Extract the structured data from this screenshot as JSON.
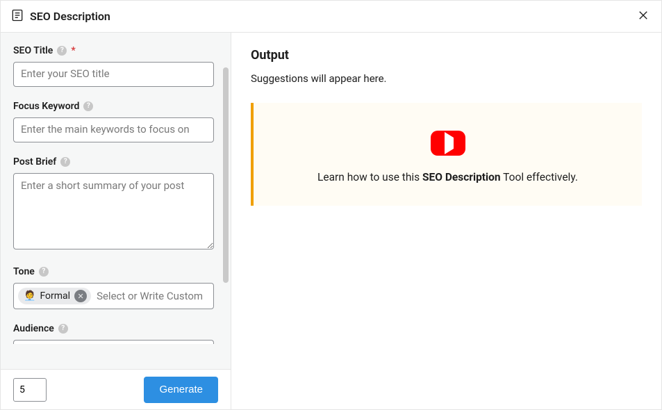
{
  "header": {
    "title": "SEO Description"
  },
  "form": {
    "seo_title": {
      "label": "SEO Title",
      "placeholder": "Enter your SEO title",
      "required_mark": "*"
    },
    "focus_keyword": {
      "label": "Focus Keyword",
      "placeholder": "Enter the main keywords to focus on"
    },
    "post_brief": {
      "label": "Post Brief",
      "placeholder": "Enter a short summary of your post"
    },
    "tone": {
      "label": "Tone",
      "chip_emoji": "🧑‍💼",
      "chip_text": "Formal",
      "placeholder": "Select or Write Custom"
    },
    "audience": {
      "label": "Audience"
    }
  },
  "footer": {
    "count": "5",
    "button": "Generate"
  },
  "output": {
    "title": "Output",
    "subtitle": "Suggestions will appear here.",
    "video": {
      "prefix": "Learn how to use this ",
      "bold": "SEO Description",
      "suffix": " Tool effectively."
    }
  }
}
